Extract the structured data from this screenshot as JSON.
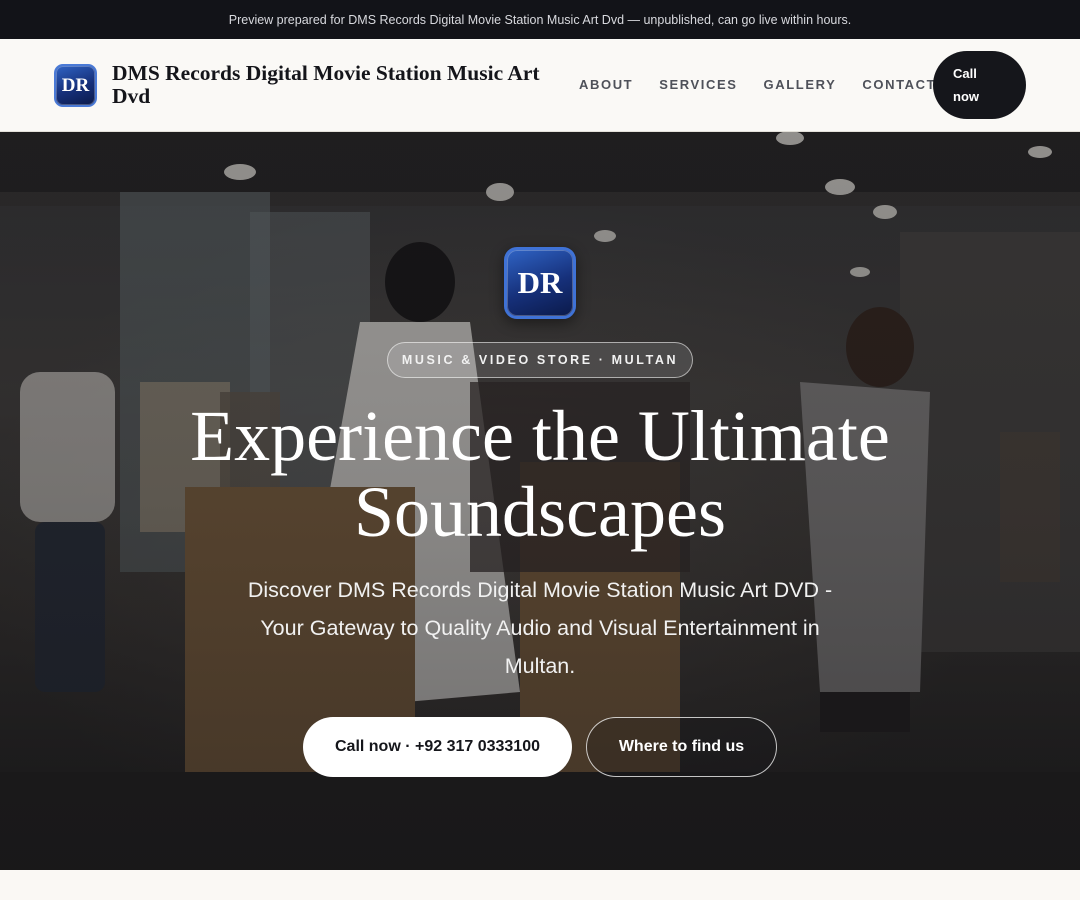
{
  "preview_bar": {
    "text": "Preview prepared for DMS Records Digital Movie Station Music Art Dvd — unpublished, can go live within hours."
  },
  "header": {
    "logo_initials": "DR",
    "brand_name": "DMS Records Digital Movie Station Music Art Dvd",
    "nav": [
      "ABOUT",
      "SERVICES",
      "GALLERY",
      "CONTACT"
    ],
    "cta_line1": "Call",
    "cta_line2": "now"
  },
  "hero": {
    "logo_initials": "DR",
    "tag": "MUSIC & VIDEO STORE · MULTAN",
    "title_line1": "Experience the Ultimate",
    "title_line2": "Soundscapes",
    "subtitle": "Discover DMS Records Digital Movie Station Music Art DVD - Your Gateway to Quality Audio and Visual Entertainment in Multan.",
    "primary_button": "Call now · +92 317 0333100",
    "secondary_button": "Where to find us"
  },
  "colors": {
    "dark": "#15161b",
    "logo_blue": "#1f3f96",
    "page_bg": "#faf8f4"
  }
}
